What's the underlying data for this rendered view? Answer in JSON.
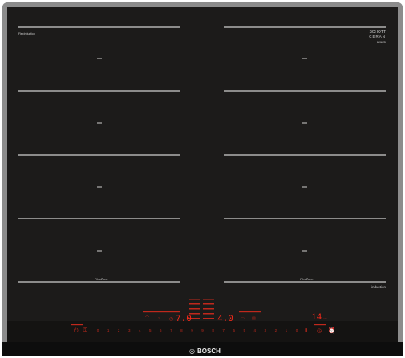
{
  "brand": "BOSCH",
  "model_label": "FlexInduction",
  "glass": {
    "brand": "SCHOTT",
    "sub": "CERAN",
    "tag": "sensorix"
  },
  "zone_label_left": "FlexZone",
  "zone_label_right": "FlexZone",
  "induction_label": "induction",
  "displays": {
    "left": "7.0",
    "center": "4.0",
    "right": "14"
  },
  "scale": [
    "0",
    "1",
    "2",
    "3",
    "4",
    "5",
    "6",
    "7",
    "8",
    "9",
    "9",
    "8",
    "7",
    "6",
    "5",
    "4",
    "3",
    "2",
    "1",
    "0"
  ],
  "colors": {
    "glass": "#1c1b1a",
    "frame": "#8a8a8a",
    "marking": "#c8c8c8",
    "display": "#ff2a1a",
    "bar": "#c0281c",
    "bottom_trim": "#0f0f0f"
  },
  "icons": {
    "power": "power-icon",
    "child_lock": "child-lock-icon",
    "timer": "timer-icon",
    "clock": "clock-icon",
    "fryer": "pan-fry-icon",
    "zone_select": "zone-select-icon"
  }
}
